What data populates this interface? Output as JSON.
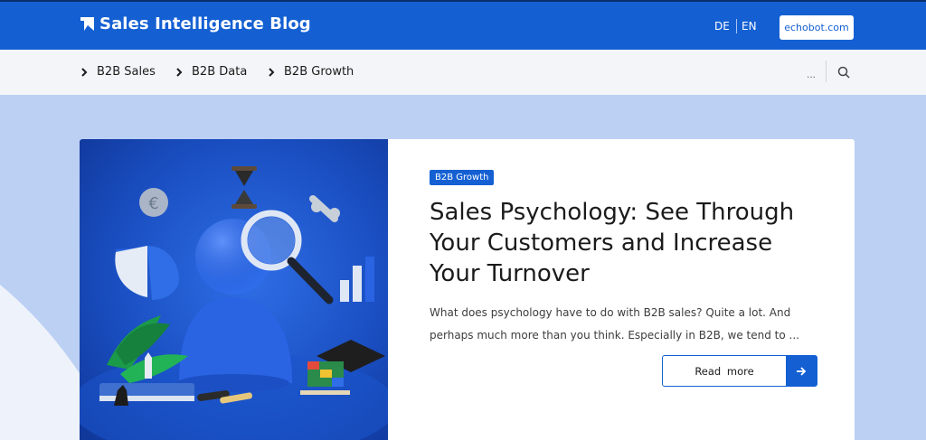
{
  "header": {
    "brand_title": "Sales Intelligence Blog",
    "brand_icon": "bookmark-logo-icon",
    "lang_de": "DE",
    "lang_en": "EN",
    "site_button": "echobot.com"
  },
  "nav": {
    "items": [
      {
        "label": "B2B Sales"
      },
      {
        "label": "B2B Data"
      },
      {
        "label": "B2B Growth"
      }
    ],
    "more": "...",
    "search_icon": "search-icon"
  },
  "post": {
    "tag": "B2B Growth",
    "title": "Sales Psychology: See Through Your Customers and Increase Your Turnover",
    "excerpt": "What does psychology have to do with B2B sales? Quite a lot. And perhaps much more than you think. Especially in B2B, we tend to ...",
    "read_more": "Read more",
    "arrow_icon": "arrow-right-icon"
  },
  "colors": {
    "brand_blue": "#1460d3",
    "page_bg": "#bcd0f4",
    "nav_bg": "#f4f5f8"
  }
}
